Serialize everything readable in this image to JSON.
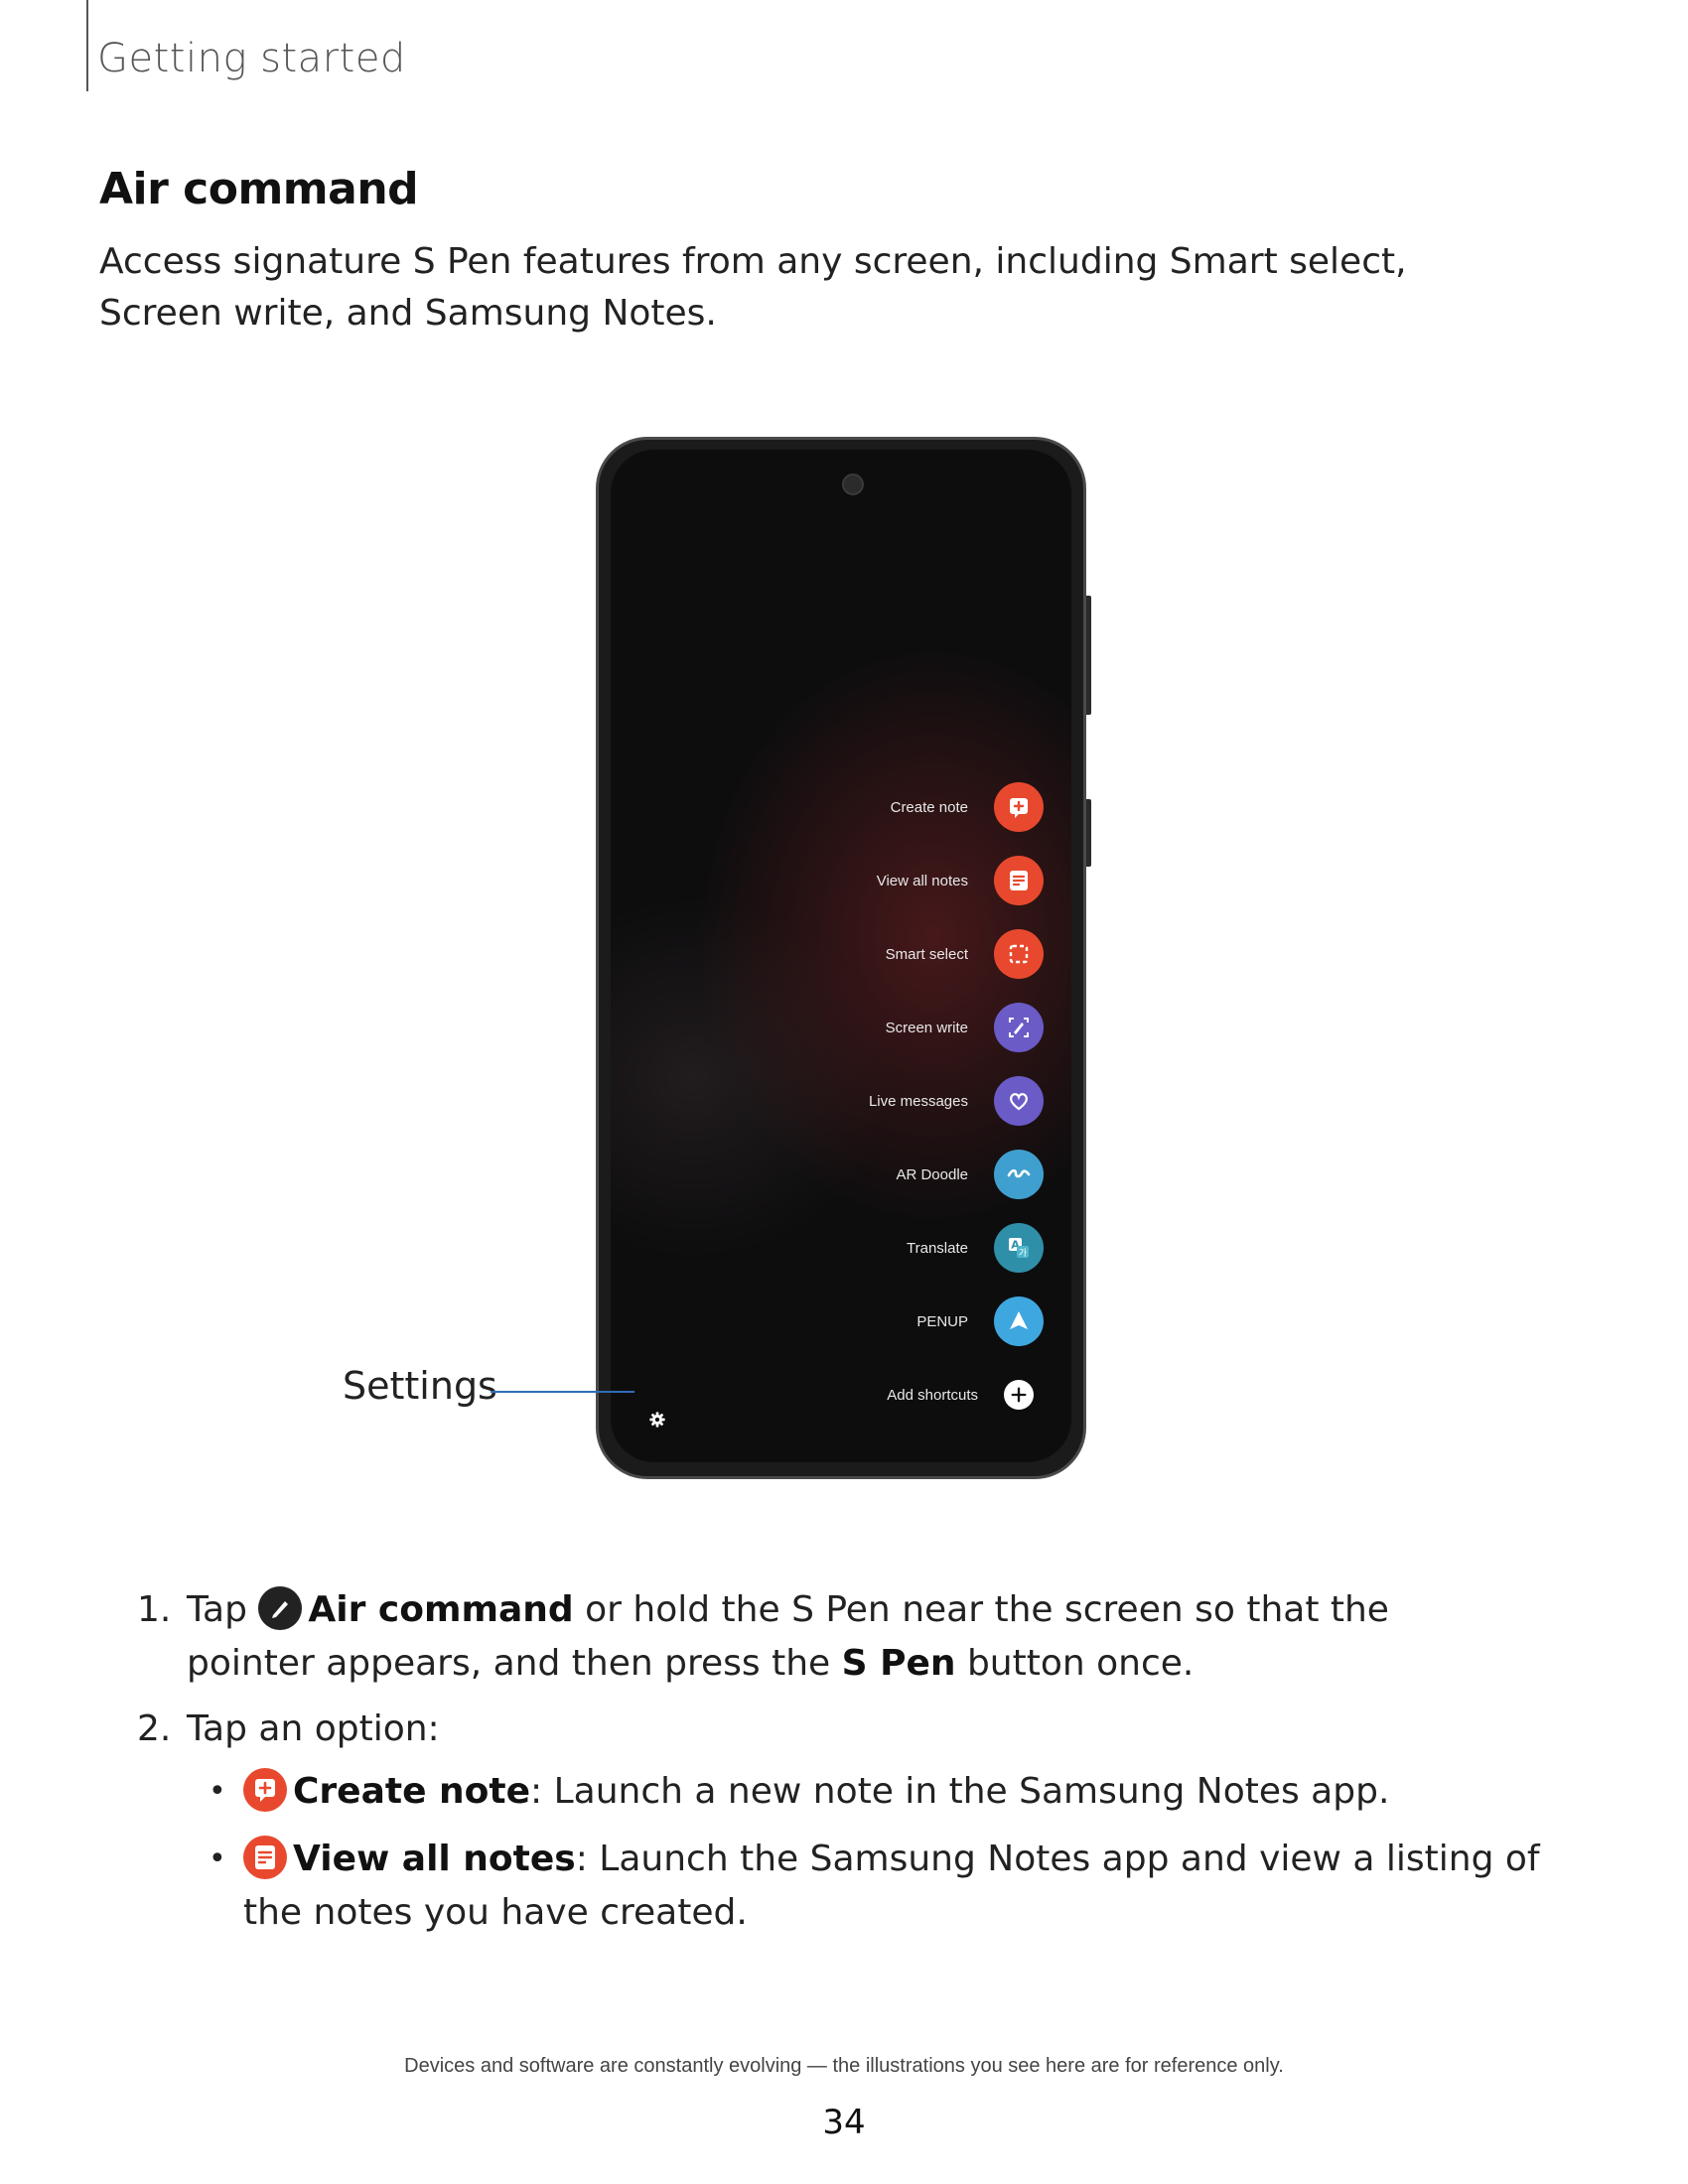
{
  "header": {
    "chapter": "Getting started"
  },
  "section": {
    "title": "Air command",
    "intro": "Access signature S Pen features from any screen, including Smart select, Screen write, and Samsung Notes."
  },
  "phone_menu": {
    "items": [
      {
        "label": "Create note",
        "icon": "create-note-icon",
        "color": "#e8492e"
      },
      {
        "label": "View all notes",
        "icon": "view-all-notes-icon",
        "color": "#e8492e"
      },
      {
        "label": "Smart select",
        "icon": "smart-select-icon",
        "color": "#e8492e"
      },
      {
        "label": "Screen write",
        "icon": "screen-write-icon",
        "color": "#6a5bc7"
      },
      {
        "label": "Live messages",
        "icon": "live-messages-icon",
        "color": "#6a5bc7"
      },
      {
        "label": "AR Doodle",
        "icon": "ar-doodle-icon",
        "color": "#3fa0cf"
      },
      {
        "label": "Translate",
        "icon": "translate-icon",
        "color": "#2f8fa8"
      },
      {
        "label": "PENUP",
        "icon": "penup-icon",
        "color": "#3fa7e0"
      },
      {
        "label": "Add shortcuts",
        "icon": "add-icon",
        "color": "#ffffff"
      }
    ]
  },
  "callout": {
    "label": "Settings",
    "color": "#2f6db5"
  },
  "steps": {
    "one": {
      "num": "1.",
      "tap": "Tap",
      "air_command": "Air command",
      "mid": " or hold the S Pen near the screen so that the pointer appears, and then press the ",
      "s_pen": "S Pen",
      "end": " button once."
    },
    "two": {
      "num": "2.",
      "text": "Tap an option:"
    }
  },
  "bullets": {
    "create": {
      "term": "Create note",
      "desc": ": Launch a new note in the Samsung Notes app."
    },
    "view": {
      "term": "View all notes",
      "desc": ": Launch the Samsung Notes app and view a listing of the notes you have created."
    }
  },
  "footer": {
    "note": "Devices and software are constantly evolving — the illustrations you see here are for reference only.",
    "page": "34"
  }
}
